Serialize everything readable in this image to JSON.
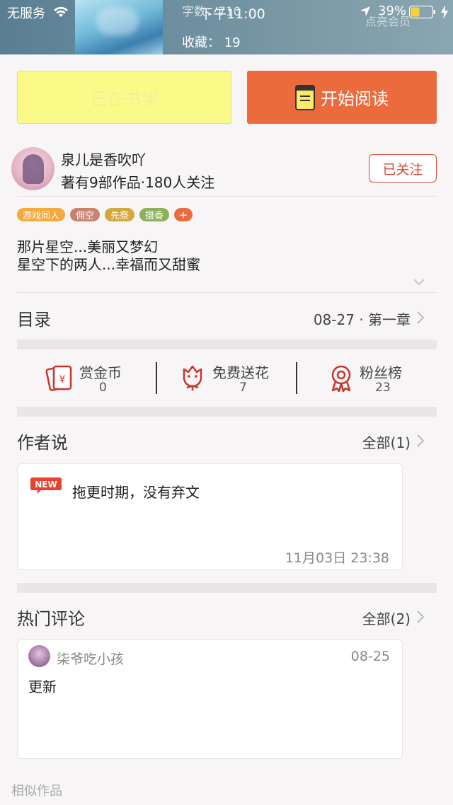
{
  "status_bar": {
    "carrier": "无服务",
    "time": "下午11:00",
    "battery": "39%"
  },
  "header": {
    "word_count": "字数：710",
    "favorites": "收藏： 19",
    "vip": "点亮会员"
  },
  "actions": {
    "shelf_label": "已在书架",
    "read_label": "开始阅读"
  },
  "author": {
    "name": "泉儿是香吹吖",
    "meta": "著有9部作品·180人关注",
    "follow_label": "已关注"
  },
  "tags": [
    {
      "label": "游戏同人",
      "color": "#f5a93a"
    },
    {
      "label": "佣空",
      "color": "#c98170"
    },
    {
      "label": "先祭",
      "color": "#d4a83a"
    },
    {
      "label": "摄香",
      "color": "#8fb05a"
    }
  ],
  "tag_more": "+",
  "synopsis": {
    "line1": "那片星空...美丽又梦幻",
    "line2": "星空下的两人...幸福而又甜蜜"
  },
  "catalog": {
    "title": "目录",
    "latest": "08-27 · 第一章"
  },
  "stats": [
    {
      "label": "赏金币",
      "value": "0",
      "icon": "red-envelope-icon"
    },
    {
      "label": "免费送花",
      "value": "7",
      "icon": "flower-icon"
    },
    {
      "label": "粉丝榜",
      "value": "23",
      "icon": "medal-icon"
    }
  ],
  "author_says": {
    "title": "作者说",
    "more": "全部(1)",
    "badge": "NEW",
    "text": "拖更时期，没有弃文",
    "time": "11月03日  23:38"
  },
  "comments": {
    "title": "热门评论",
    "more": "全部(2)",
    "items": [
      {
        "user": "柒爷吃小孩",
        "date": "08-25",
        "text": "更新"
      }
    ]
  },
  "similar_title": "相似作品",
  "colors": {
    "accent": "#ec6b3d",
    "follow": "#d9473a",
    "shelf": "#fafa88"
  }
}
